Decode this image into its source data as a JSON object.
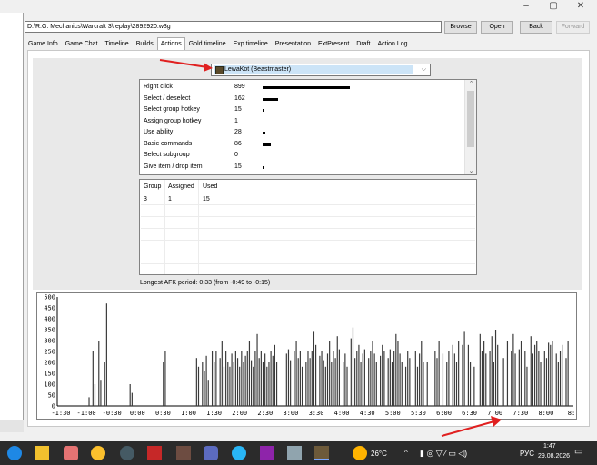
{
  "window": {
    "minimize": "–",
    "maximize": "▢",
    "close": "✕"
  },
  "toolbar": {
    "path": "D:\\R.G. Mechanics\\Warcraft 3\\replay\\2892920.w3g",
    "browse": "Browse",
    "open": "Open",
    "back": "Back",
    "forward": "Forward"
  },
  "tabs": [
    "Game Info",
    "Game Chat",
    "Timeline",
    "Builds",
    "Actions",
    "Gold timeline",
    "Exp timeline",
    "Presentation",
    "ExtPresent",
    "Draft",
    "Action Log"
  ],
  "active_tab": "Actions",
  "player_select": {
    "value": "LewaKot (Beastmaster)",
    "hero_icon": "beastmaster-portrait-icon"
  },
  "actions": [
    {
      "name": "Right click",
      "count": "899",
      "fraction": 1.0
    },
    {
      "name": "Select / deselect",
      "count": "162",
      "fraction": 0.18
    },
    {
      "name": "Select group hotkey",
      "count": "15",
      "fraction": 0.017
    },
    {
      "name": "Assign group hotkey",
      "count": "1",
      "fraction": 0.0
    },
    {
      "name": "Use ability",
      "count": "28",
      "fraction": 0.031
    },
    {
      "name": "Basic commands",
      "count": "86",
      "fraction": 0.096
    },
    {
      "name": "Select subgroup",
      "count": "0",
      "fraction": 0.0
    },
    {
      "name": "Give item / drop item",
      "count": "15",
      "fraction": 0.017
    }
  ],
  "groups": {
    "headers": [
      "Group",
      "Assigned",
      "Used"
    ],
    "rows": [
      [
        "3",
        "1",
        "15"
      ]
    ]
  },
  "afk_text": "Longest AFK period: 0:33 (from -0:49 to -0:15)",
  "chart_data": {
    "type": "bar",
    "y_ticks": [
      "0",
      "50",
      "100",
      "150",
      "200",
      "250",
      "300",
      "350",
      "400",
      "450",
      "500"
    ],
    "ylim": [
      0,
      500
    ],
    "x_ticks": [
      "-1:30",
      "-1:00",
      "-0:30",
      "0:00",
      "0:30",
      "1:00",
      "1:30",
      "2:00",
      "2:30",
      "3:00",
      "3:30",
      "4:00",
      "4:30",
      "5:00",
      "5:30",
      "6:00",
      "6:30",
      "7:00",
      "7:30",
      "8:00",
      "8:"
    ],
    "bar_color": "#3a3a3a",
    "values": [
      0,
      0,
      0,
      0,
      0,
      0,
      0,
      0,
      0,
      0,
      0,
      0,
      0,
      0,
      0,
      0,
      40,
      0,
      250,
      100,
      0,
      300,
      120,
      0,
      200,
      470,
      0,
      0,
      0,
      0,
      0,
      0,
      0,
      0,
      0,
      0,
      0,
      100,
      60,
      0,
      0,
      0,
      0,
      0,
      0,
      0,
      0,
      0,
      0,
      0,
      0,
      0,
      0,
      0,
      200,
      250,
      0,
      0,
      0,
      0,
      0,
      0,
      0,
      0,
      0,
      0,
      0,
      0,
      0,
      0,
      0,
      220,
      180,
      0,
      200,
      160,
      230,
      120,
      0,
      250,
      200,
      250,
      0,
      220,
      300,
      180,
      250,
      200,
      180,
      240,
      200,
      250,
      220,
      180,
      250,
      200,
      230,
      250,
      300,
      210,
      180,
      250,
      330,
      220,
      250,
      200,
      240,
      180,
      200,
      250,
      230,
      280,
      200,
      0,
      0,
      0,
      0,
      240,
      260,
      210,
      0,
      250,
      300,
      220,
      250,
      180,
      0,
      200,
      250,
      220,
      250,
      340,
      280,
      0,
      230,
      250,
      210,
      180,
      240,
      300,
      200,
      250,
      220,
      320,
      260,
      0,
      200,
      240,
      180,
      0,
      310,
      360,
      220,
      250,
      280,
      200,
      240,
      260,
      0,
      220,
      250,
      300,
      240,
      200,
      0,
      230,
      280,
      250,
      0,
      220,
      260,
      200,
      250,
      330,
      300,
      240,
      200,
      0,
      180,
      250,
      220,
      0,
      0,
      250,
      180,
      240,
      300,
      200,
      0,
      200,
      0,
      0,
      0,
      250,
      220,
      300,
      0,
      240,
      0,
      200,
      250,
      0,
      280,
      240,
      200,
      300,
      0,
      280,
      340,
      0,
      280,
      200,
      0,
      180,
      0,
      0,
      330,
      250,
      300,
      240,
      0,
      250,
      320,
      200,
      350,
      280,
      0,
      0,
      220,
      0,
      300,
      0,
      250,
      330,
      240,
      0,
      260,
      300,
      0,
      250,
      180,
      0,
      320,
      240,
      280,
      300,
      250,
      200,
      0,
      250,
      220,
      290,
      280,
      300,
      0,
      240,
      200,
      250,
      280,
      0,
      220,
      300,
      0,
      0
    ]
  },
  "taskbar": {
    "weather": "26°C",
    "lang": "РУС",
    "time": "1:47",
    "date": "29.08.2026"
  }
}
